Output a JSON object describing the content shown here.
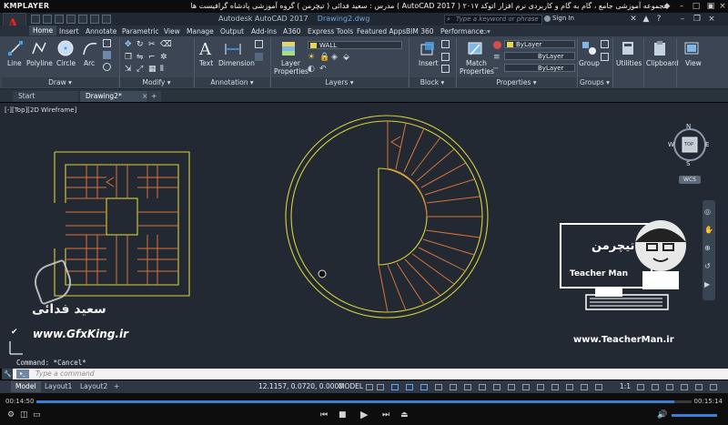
{
  "player": {
    "logo": "KMPLAYER",
    "file_title": "مجموعه آموزشی جامع ، گام به گام و کاربردی نرم افزار  اتوکد ۲۰۱۷ ( AutoCAD 2017 )   مدرس : سعید فدائی ( تیچرمن ) گروه آموزشی پادشاه گرافیست ها",
    "time_current": "00:14:50",
    "time_total": "00:15:14",
    "progress": 0.974
  },
  "acad": {
    "app_letter": "A",
    "product_title": "Autodesk AutoCAD 2017",
    "drawing_name": "Drawing2.dwg",
    "search_placeholder": "Type a keyword or phrase",
    "signin": "Sign In"
  },
  "ribbon_tabs": [
    "Home",
    "Insert",
    "Annotate",
    "Parametric",
    "View",
    "Manage",
    "Output",
    "Add-ins",
    "A360",
    "Express Tools",
    "Featured Apps",
    "BIM 360",
    "Performance"
  ],
  "ribbon": {
    "draw": {
      "line": "Line",
      "polyline": "Polyline",
      "circle": "Circle",
      "arc": "Arc",
      "footer": "Draw"
    },
    "modify": {
      "footer": "Modify"
    },
    "annotation": {
      "text": "Text",
      "dimension": "Dimension",
      "footer": "Annotation"
    },
    "layers": {
      "layer_properties_1": "Layer",
      "layer_properties_2": "Properties",
      "current_layer": "WALL",
      "footer": "Layers"
    },
    "block": {
      "insert": "Insert",
      "footer": "Block"
    },
    "properties": {
      "match_1": "Match",
      "match_2": "Properties",
      "color": "ByLayer",
      "linetype": "ByLayer",
      "lineweight": "ByLayer",
      "footer": "Properties"
    },
    "groups": {
      "group": "Group",
      "footer": "Groups"
    },
    "utilities": "Utilities",
    "clipboard": "Clipboard",
    "view": "View"
  },
  "file_tabs": [
    "Start",
    "Drawing2*"
  ],
  "viewport_label": "[-][Top][2D Wireframe]",
  "viewcube": {
    "n": "N",
    "s": "S",
    "e": "E",
    "w": "W",
    "top": "TOP",
    "wcs": "WCS"
  },
  "command": {
    "history": "Command: *Cancel*",
    "placeholder": "Type a command"
  },
  "status": {
    "layout_tabs": [
      "Model",
      "Layout1",
      "Layout2"
    ],
    "coords": "12.1157, 0.0720, 0.0000",
    "mode": "MODEL",
    "scale": "1:1"
  },
  "watermarks": {
    "left_site": "www.GfxKing.ir",
    "right_site": "www.TeacherMan.ir",
    "author_fa": "سعید فدائی",
    "brand_fa": "تیچرمن",
    "brand_en": "Teacher Man"
  },
  "colors": {
    "ribbon_bg": "#3b4553",
    "canvas_bg": "#222933",
    "outline_yellow": "#d9d23a",
    "stair_orange": "#d9743a"
  }
}
